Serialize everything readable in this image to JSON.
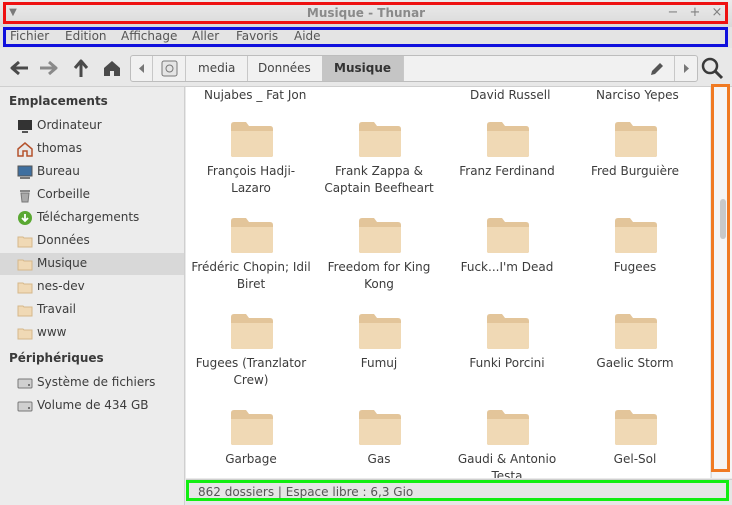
{
  "window": {
    "title": "Musique - Thunar"
  },
  "menubar": {
    "items": [
      "Fichier",
      "Edition",
      "Affichage",
      "Aller",
      "Favoris",
      "Aide"
    ]
  },
  "toolbar": {
    "back_icon": "arrow-left-icon",
    "forward_icon": "arrow-right-icon",
    "up_icon": "arrow-up-icon",
    "home_icon": "home-icon",
    "breadcrumbs": [
      "media",
      "Données",
      "Musique"
    ],
    "active_crumb": "Musique"
  },
  "sidebar": {
    "places_header": "Emplacements",
    "places": [
      {
        "label": "Ordinateur",
        "icon": "computer-icon"
      },
      {
        "label": "thomas",
        "icon": "home-icon"
      },
      {
        "label": "Bureau",
        "icon": "desktop-icon"
      },
      {
        "label": "Corbeille",
        "icon": "trash-icon"
      },
      {
        "label": "Téléchargements",
        "icon": "download-icon"
      },
      {
        "label": "Données",
        "icon": "folder-icon"
      },
      {
        "label": "Musique",
        "icon": "folder-icon",
        "selected": true
      },
      {
        "label": "nes-dev",
        "icon": "folder-icon"
      },
      {
        "label": "Travail",
        "icon": "folder-icon"
      },
      {
        "label": "www",
        "icon": "folder-icon"
      }
    ],
    "devices_header": "Périphériques",
    "devices": [
      {
        "label": "Système de fichiers",
        "icon": "drive-icon"
      },
      {
        "label": "Volume de 434 GB",
        "icon": "drive-icon"
      }
    ]
  },
  "main": {
    "partial_row": [
      "Nujabes _ Fat Jon",
      "",
      "David Russell",
      "Narciso Yepes"
    ],
    "folders": [
      [
        "François Hadji-Lazaro",
        "Frank Zappa & Captain Beefheart",
        "Franz Ferdinand",
        "Fred Burguière"
      ],
      [
        "Frédéric Chopin; Idil Biret",
        "Freedom for King Kong",
        "Fuck...I'm Dead",
        "Fugees"
      ],
      [
        "Fugees (Tranzlator Crew)",
        "Fumuj",
        "Funki Porcini",
        "Gaelic Storm"
      ],
      [
        "Garbage",
        "Gas",
        "Gaudi & Antonio Testa",
        "Gel-Sol"
      ]
    ]
  },
  "statusbar": {
    "text": "862 dossiers  |  Espace libre : 6,3 Gio"
  },
  "colors": {
    "folder": "#f0d9b5",
    "folder_dark": "#e3c59a",
    "selected_row": "#d8d8d8"
  }
}
